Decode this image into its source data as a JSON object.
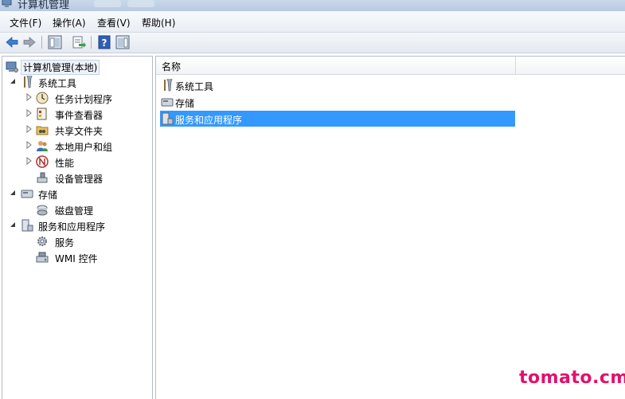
{
  "window": {
    "title": "计算机管理"
  },
  "menu": {
    "file": "文件(F)",
    "action": "操作(A)",
    "view": "查看(V)",
    "help": "帮助(H)"
  },
  "tree": {
    "root": "计算机管理(本地)",
    "system_tools": "系统工具",
    "task_scheduler": "任务计划程序",
    "event_viewer": "事件查看器",
    "shared_folders": "共享文件夹",
    "local_users": "本地用户和组",
    "performance": "性能",
    "device_manager": "设备管理器",
    "storage": "存储",
    "disk_management": "磁盘管理",
    "services_apps": "服务和应用程序",
    "services": "服务",
    "wmi": "WMI 控件"
  },
  "list": {
    "column_name": "名称",
    "items": [
      "系统工具",
      "存储",
      "服务和应用程序"
    ],
    "selected_index": 2
  },
  "watermark": "tomato.cm",
  "colors": {
    "selection": "#3399ff",
    "watermark": "#e3106d",
    "window_frame": "#b7cbe3"
  }
}
